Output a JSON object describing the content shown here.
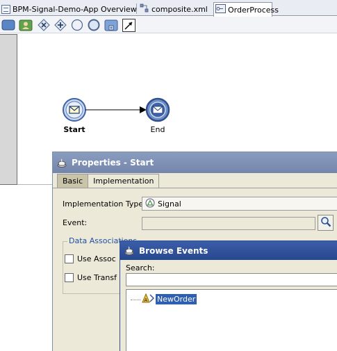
{
  "editor_tabs": [
    {
      "label": "BPM-Signal-Demo-App Overview",
      "icon": "overview-icon"
    },
    {
      "label": "composite.xml",
      "icon": "composite-icon"
    },
    {
      "label": "OrderProcess",
      "icon": "process-icon",
      "active": true
    }
  ],
  "palette": [
    {
      "name": "activity-tool-icon"
    },
    {
      "name": "user-task-tool-icon"
    },
    {
      "name": "exclusive-gateway-tool-icon"
    },
    {
      "name": "parallel-gateway-tool-icon"
    },
    {
      "name": "start-event-tool-icon"
    },
    {
      "name": "end-event-tool-icon"
    },
    {
      "name": "subprocess-tool-icon"
    },
    {
      "name": "connector-tool-icon"
    }
  ],
  "diagram": {
    "start_label": "Start",
    "end_label": "End"
  },
  "properties_dialog": {
    "title": "Properties - Start",
    "tabs": [
      "Basic",
      "Implementation"
    ],
    "implementation_type_label": "Implementation Type:",
    "implementation_type_value": "Signal",
    "event_label": "Event:",
    "data_associations_title": "Data Associations",
    "use_associations_label": "Use Assoc",
    "use_transformations_label": "Use Transf"
  },
  "browse_dialog": {
    "title": "Browse Events",
    "search_label": "Search:",
    "search_value": "",
    "tree_items": [
      "NewOrder"
    ]
  },
  "colors": {
    "selection": "#2f5fb0",
    "browse_titlebar": "#27478e",
    "props_titlebar": "#7385aa",
    "event_circle": "#3f63a8"
  }
}
